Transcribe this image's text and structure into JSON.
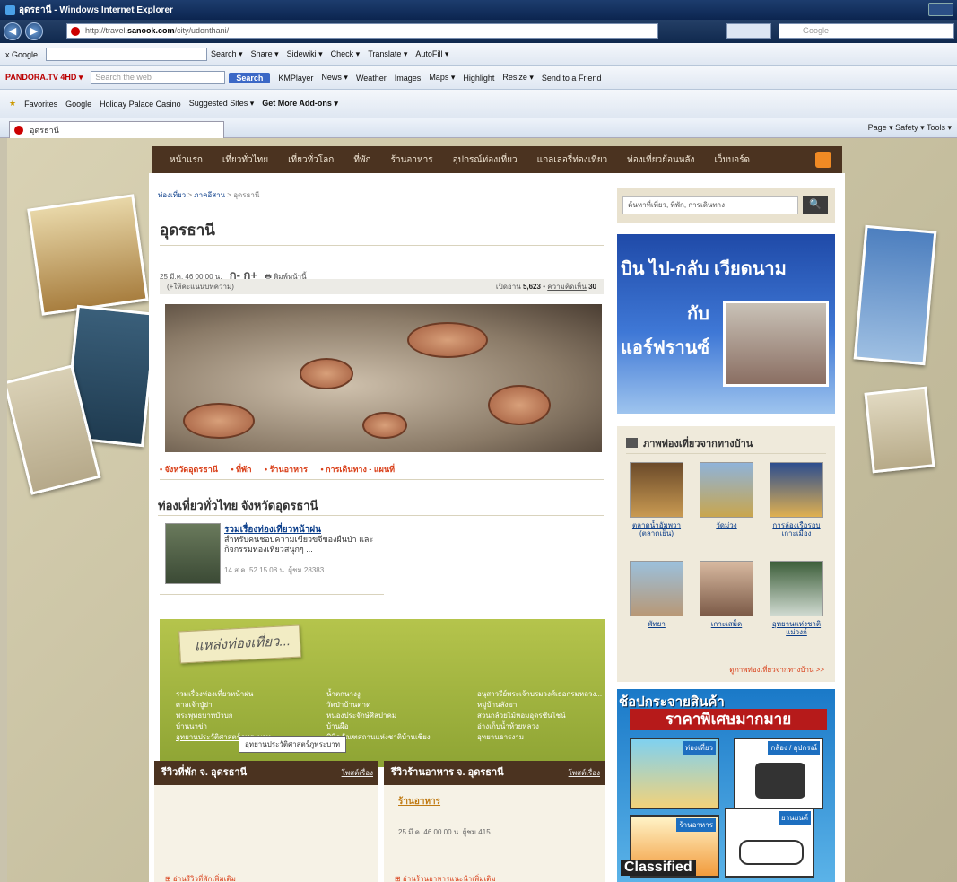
{
  "window": {
    "title": "อุดรธานี - Windows Internet Explorer"
  },
  "address": {
    "url_prefix": "http://travel.",
    "url_host": "sanook.com",
    "url_path": "/city/udonthani/",
    "search_placeholder": "Google"
  },
  "toolbars": {
    "google_row": [
      "x Google",
      "Search ▾",
      "Share ▾",
      "Sidewiki ▾",
      "Check ▾",
      "Translate ▾",
      "AutoFill ▾"
    ],
    "pandora_row": {
      "brand": "PANDORA.TV 4HD ▾",
      "search_placeholder": "Search the web",
      "search_btn": "Search",
      "items": [
        "KMPlayer",
        "News ▾",
        "Weather",
        "Images",
        "Maps ▾",
        "Highlight",
        "Resize ▾",
        "Send to a Friend"
      ]
    },
    "favorites_row": [
      "Favorites",
      "Google",
      "Holiday Palace Casino",
      "Suggested Sites ▾",
      "Get More Add-ons ▾"
    ]
  },
  "tab": {
    "label": "อุดรธานี",
    "tools": "Page ▾  Safety ▾  Tools ▾"
  },
  "site_nav": [
    "หน้าแรก",
    "เที่ยวทั่วไทย",
    "เที่ยวทั่วโลก",
    "ที่พัก",
    "ร้านอาหาร",
    "อุปกรณ์ท่องเที่ยว",
    "แกลเลอรี่ท่องเที่ยว",
    "ท่องเที่ยวย้อนหลัง",
    "เว็บบอร์ด"
  ],
  "breadcrumb": {
    "a": "ท่องเที่ยว",
    "b": "ภาคอีสาน",
    "c": "อุดรธานี"
  },
  "page_title": "อุดรธานี",
  "meta": {
    "date": "25 มี.ค. 46 00.00 น.",
    "font_size": "ก- ก+",
    "print": "พิมพ์หน้านี้"
  },
  "stats": {
    "left": "(+ให้คะแนนบทความ)",
    "views_label": "เปิดอ่าน",
    "views": "5,623",
    "comments_label": "ความคิดเห็น",
    "comments": "30"
  },
  "sublinks": [
    "• จังหวัดอุดรธานี",
    "• ที่พัก",
    "• ร้านอาหาร",
    "• การเดินทาง - แผนที่"
  ],
  "section_title": "ท่องเที่ยวทั่วไทย จังหวัดอุดรธานี",
  "story": {
    "title": "รวมเรื่องท่องเที่ยวหน้าฝน",
    "desc": "สำหรับคนชอบความเขียวขจีของผืนป่า และกิจกรรมท่องเที่ยวสนุกๆ ...",
    "meta": "14 ส.ค. 52 15.08 น.  ผู้ชม 28383"
  },
  "attractions": {
    "heading": "แหล่งท่องเที่ยว...",
    "col1": [
      "รวมเรื่องท่องเที่ยวหน้าฝน",
      "ศาลเจ้าปู่ย่า",
      "พระพุทธบาทบัวบก",
      "บ้านนาข่า",
      "อุทยานประวัติศาสตร์ภูพระบาท"
    ],
    "col2": [
      "น้ำตกนางงู",
      "วัดป่าบ้านตาด",
      "หนองประจักษ์ศิลปาคม",
      "บ้านผือ",
      "พิพิธภัณฑสถานแห่งชาติบ้านเชียง"
    ],
    "col3": [
      "อนุสาวรีย์พระเจ้าบรมวงศ์เธอกรมหลวง...",
      "หมู่บ้านสังขา",
      "สวนกล้วยไม้หอมอุดรซันไชน์",
      "อ่างเก็บน้ำห้วยหลวง",
      "อุทยานธารงาม"
    ],
    "tooltip": "อุทยานประวัติศาสตร์ภูพระบาท"
  },
  "reviews": {
    "hotel_title": "รีวิวที่พัก จ. อุดรธานี",
    "hotel_post": "โพสต์เรื่อง",
    "hotel_more": "⊞ อ่านรีวิวที่พักเพิ่มเติม",
    "food_title": "รีวิวร้านอาหาร จ. อุดรธานี",
    "food_post": "โพสต์เรื่อง",
    "food_link": "ร้านอาหาร",
    "food_meta": "25 มี.ค. 46 00.00 น.  ผู้ชม 415",
    "food_more": "⊞ อ่านร้านอาหารแนะนำเพิ่มเติม"
  },
  "search": {
    "placeholder": "ค้นหาที่เที่ยว, ที่พัก, การเดินทาง",
    "button": "🔍"
  },
  "ad_airasia": {
    "l1": "บิน ไป-กลับ เวียดนาม",
    "l2": "กับ",
    "l3": "แอร์ฟรานซ์"
  },
  "gallery": {
    "heading": "ภาพท่องเที่ยวจากทางบ้าน",
    "items": [
      "ตลาดน้ำอัมพวา (ตลาดเย็น)",
      "วัดม่วง",
      "การล่องเรือรอบเกาะเมือง",
      "พัทยา",
      "เกาะเสม็ด",
      "อุทยานแห่งชาติแม่วงก์"
    ],
    "more": "ดูภาพท่องเที่ยวจากทางบ้าน >>"
  },
  "ad_classified": {
    "t1": "ช้อปกระจายสินค้า",
    "t2": "ราคาพิเศษมากมาย",
    "card1": "ท่องเที่ยว",
    "card2": "กล้อง / อุปกรณ์",
    "card3": "ร้านอาหาร",
    "card4": "ยานยนต์",
    "brand": "Classified"
  }
}
